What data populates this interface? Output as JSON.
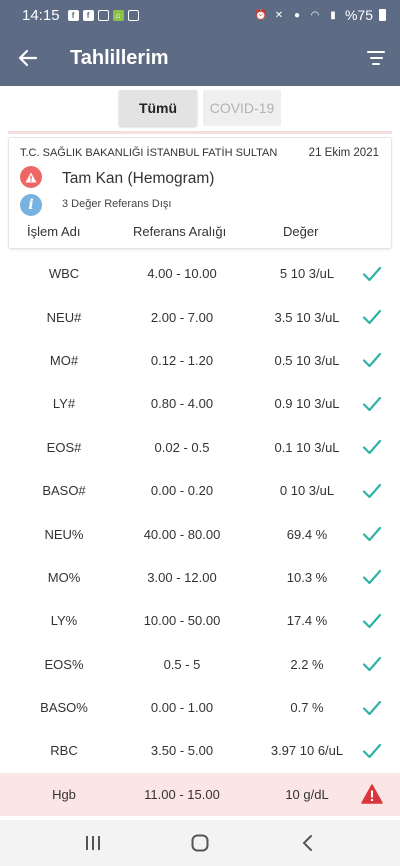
{
  "status_bar": {
    "time": "14:15",
    "left_icons": [
      "facebook-icon",
      "facebook-icon",
      "instagram-icon",
      "home-app-icon",
      "gallery-icon"
    ],
    "right_icons": [
      "alarm-icon",
      "mute-icon",
      "location-icon",
      "wifi-icon",
      "signal-icon"
    ],
    "battery_text": "%75"
  },
  "app_bar": {
    "title": "Tahlillerim",
    "back_icon": "arrow-left-icon",
    "filter_icon": "filter-icon",
    "color": "#5e6b84"
  },
  "tabs": [
    {
      "label": "Tümü",
      "active": true
    },
    {
      "label": "COVID-19",
      "active": false
    }
  ],
  "report": {
    "hospital": "T.C. SAĞLIK BAKANLIĞI İSTANBUL FATİH SULTAN",
    "date": "21 Ekim 2021",
    "test_name": "Tam Kan (Hemogram)",
    "out_of_range_text": "3 Değer Referans Dışı",
    "columns": {
      "name": "İşlem Adı",
      "range": "Referans Aralığı",
      "value": "Değer"
    }
  },
  "results": [
    {
      "name": "WBC",
      "range": "4.00 - 10.00",
      "value": "5 10 3/uL",
      "status": "normal"
    },
    {
      "name": "NEU#",
      "range": "2.00 - 7.00",
      "value": "3.5 10 3/uL",
      "status": "normal"
    },
    {
      "name": "MO#",
      "range": "0.12 - 1.20",
      "value": "0.5 10 3/uL",
      "status": "normal"
    },
    {
      "name": "LY#",
      "range": "0.80 - 4.00",
      "value": "0.9 10 3/uL",
      "status": "normal"
    },
    {
      "name": "EOS#",
      "range": "0.02 - 0.5",
      "value": "0.1 10 3/uL",
      "status": "normal"
    },
    {
      "name": "BASO#",
      "range": "0.00 - 0.20",
      "value": "0 10 3/uL",
      "status": "normal"
    },
    {
      "name": "NEU%",
      "range": "40.00 - 80.00",
      "value": "69.4 %",
      "status": "normal"
    },
    {
      "name": "MO%",
      "range": "3.00 - 12.00",
      "value": "10.3 %",
      "status": "normal"
    },
    {
      "name": "LY%",
      "range": "10.00 - 50.00",
      "value": "17.4 %",
      "status": "normal"
    },
    {
      "name": "EOS%",
      "range": "0.5 - 5",
      "value": "2.2 %",
      "status": "normal"
    },
    {
      "name": "BASO%",
      "range": "0.00 - 1.00",
      "value": "0.7 %",
      "status": "normal"
    },
    {
      "name": "RBC",
      "range": "3.50 - 5.00",
      "value": "3.97 10 6/uL",
      "status": "normal"
    },
    {
      "name": "Hgb",
      "range": "11.00 - 15.00",
      "value": "10 g/dL",
      "status": "alert"
    }
  ],
  "colors": {
    "normal_check": "#2fb3a4",
    "alert_icon": "#d9363e",
    "alert_row_bg": "#fce5e5"
  },
  "nav_bar": [
    "recents-icon",
    "home-icon",
    "back-icon"
  ]
}
